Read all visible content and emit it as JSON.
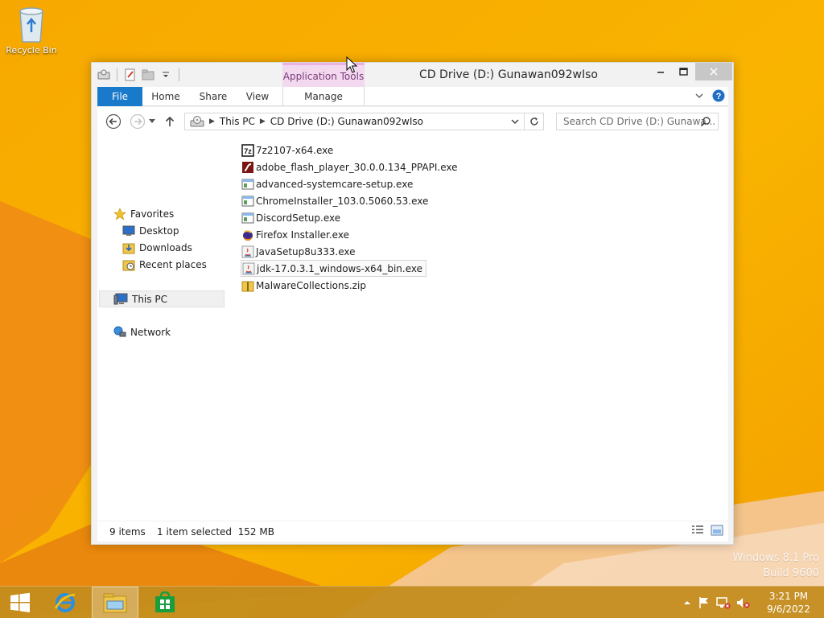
{
  "desktop": {
    "recycle_bin_label": "Recycle Bin",
    "watermark_line1": "Windows 8.1 Pro",
    "watermark_line2": "Build 9600"
  },
  "window": {
    "title": "CD Drive (D:) Gunawan092wIso",
    "context_tab_group": "Application Tools",
    "ribbon_tabs": {
      "file": "File",
      "home": "Home",
      "share": "Share",
      "view": "View",
      "manage": "Manage"
    },
    "breadcrumb": [
      "This PC",
      "CD Drive (D:) Gunawan092wIso"
    ],
    "search_placeholder": "Search CD Drive (D:) Gunawa...",
    "nav_pane": {
      "favorites": "Favorites",
      "desktop": "Desktop",
      "downloads": "Downloads",
      "recent_places": "Recent places",
      "this_pc": "This PC",
      "network": "Network"
    },
    "files": [
      {
        "name": "7z2107-x64.exe",
        "icon": "7zip-icon"
      },
      {
        "name": "adobe_flash_player_30.0.0.134_PPAPI.exe",
        "icon": "flash-icon"
      },
      {
        "name": "advanced-systemcare-setup.exe",
        "icon": "app-window-icon"
      },
      {
        "name": "ChromeInstaller_103.0.5060.53.exe",
        "icon": "app-window-icon"
      },
      {
        "name": "DiscordSetup.exe",
        "icon": "app-window-icon"
      },
      {
        "name": "Firefox Installer.exe",
        "icon": "firefox-icon"
      },
      {
        "name": "JavaSetup8u333.exe",
        "icon": "java-icon"
      },
      {
        "name": "jdk-17.0.3.1_windows-x64_bin.exe",
        "icon": "java-icon"
      },
      {
        "name": "MalwareCollections.zip",
        "icon": "zip-folder-icon"
      }
    ],
    "selected_file_index": 7,
    "status": {
      "item_count": "9 items",
      "selection": "1 item selected  152 MB"
    }
  },
  "taskbar": {
    "time": "3:21 PM",
    "date": "9/6/2022"
  },
  "colors": {
    "file_tab": "#1979ca",
    "context_tab": "#f2d9f0",
    "taskbar": "#c48c1e"
  }
}
